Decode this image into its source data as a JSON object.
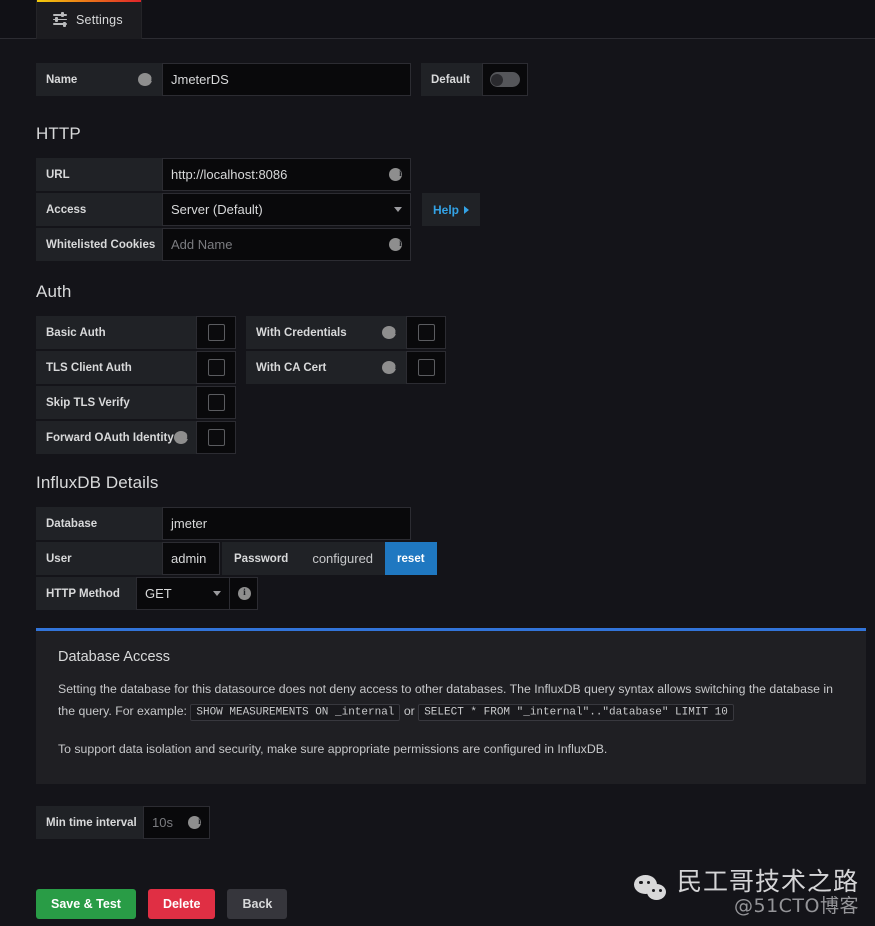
{
  "tab": {
    "label": "Settings",
    "icon": "sliders-icon"
  },
  "name_row": {
    "label": "Name",
    "value": "JmeterDS",
    "default_label": "Default",
    "default_on": false
  },
  "http": {
    "title": "HTTP",
    "url": {
      "label": "URL",
      "value": "http://localhost:8086"
    },
    "access": {
      "label": "Access",
      "value": "Server (Default)"
    },
    "help_label": "Help",
    "cookies": {
      "label": "Whitelisted Cookies",
      "placeholder": "Add Name"
    }
  },
  "auth": {
    "title": "Auth",
    "left": [
      {
        "label": "Basic Auth",
        "checked": false,
        "info": false
      },
      {
        "label": "TLS Client Auth",
        "checked": false,
        "info": false
      },
      {
        "label": "Skip TLS Verify",
        "checked": false,
        "info": false
      },
      {
        "label": "Forward OAuth Identity",
        "checked": false,
        "info": true
      }
    ],
    "right": [
      {
        "label": "With Credentials",
        "checked": false,
        "info": true
      },
      {
        "label": "With CA Cert",
        "checked": false,
        "info": true
      }
    ]
  },
  "influx": {
    "title": "InfluxDB Details",
    "database": {
      "label": "Database",
      "value": "jmeter"
    },
    "user": {
      "label": "User",
      "value": "admin"
    },
    "password": {
      "label": "Password",
      "value": "configured",
      "reset_label": "reset"
    },
    "http_method": {
      "label": "HTTP Method",
      "value": "GET"
    }
  },
  "db_access": {
    "title": "Database Access",
    "paragraph1_a": "Setting the database for this datasource does not deny access to other databases. The InfluxDB query syntax allows switching the database in the query. For example:",
    "code1": "SHOW MEASUREMENTS ON _internal",
    "or": "or",
    "code2": "SELECT * FROM \"_internal\"..\"database\" LIMIT 10",
    "paragraph2": "To support data isolation and security, make sure appropriate permissions are configured in InfluxDB.",
    "accent_color": "#3274d9"
  },
  "min_interval": {
    "label": "Min time interval",
    "placeholder": "10s"
  },
  "actions": {
    "save_label": "Save & Test",
    "delete_label": "Delete",
    "back_label": "Back",
    "save_color": "#299c46",
    "delete_color": "#e02f44"
  },
  "watermark": {
    "main": "民工哥技术之路",
    "sub": "@51CTO博客"
  }
}
